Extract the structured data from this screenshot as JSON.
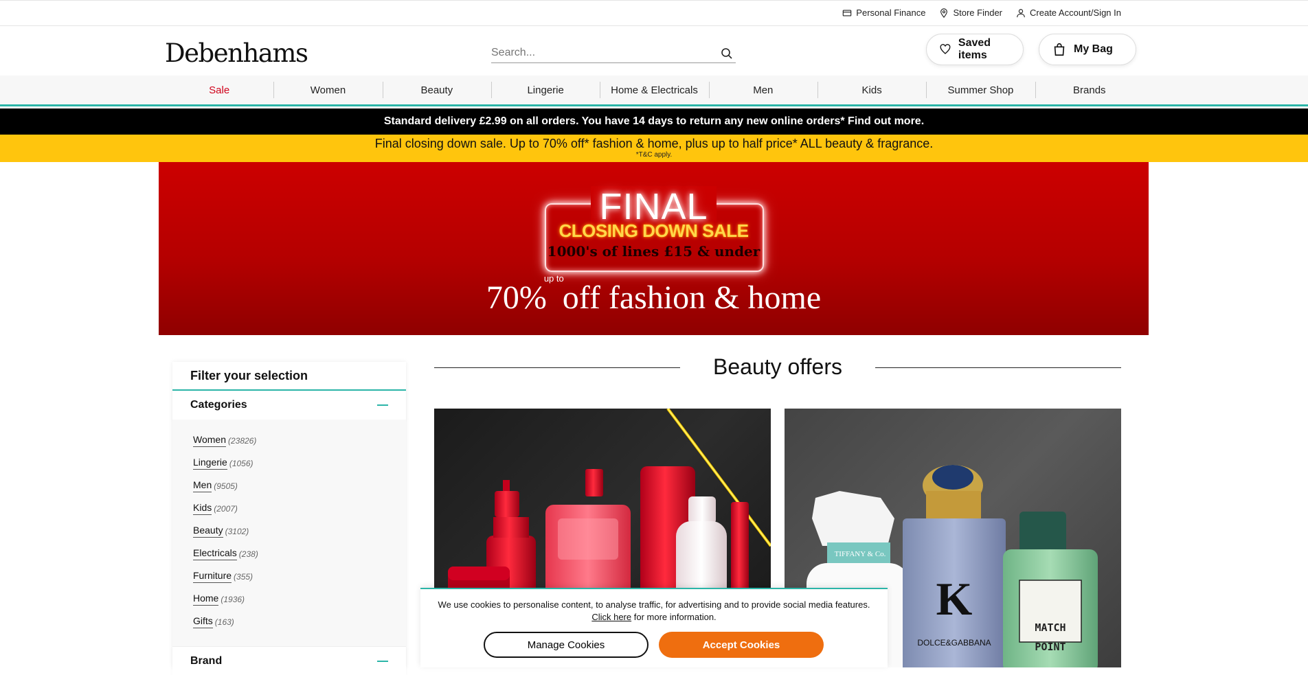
{
  "utility": {
    "personal_finance": "Personal Finance",
    "store_finder": "Store Finder",
    "account": "Create Account/Sign In"
  },
  "header": {
    "logo": "Debenhams",
    "search_placeholder": "Search...",
    "saved_items": "Saved items",
    "my_bag": "My Bag"
  },
  "nav": {
    "items": [
      "Sale",
      "Women",
      "Beauty",
      "Lingerie",
      "Home & Electricals",
      "Men",
      "Kids",
      "Summer Shop",
      "Brands"
    ]
  },
  "delivery_banner": "Standard delivery £2.99 on all orders. You have 14 days to return any new online orders* Find out more.",
  "promo_banner": {
    "main": "Final closing down sale. Up to 70% off* fashion & home, plus up to half price* ALL beauty & fragrance.",
    "tc": "*T&C apply."
  },
  "hero": {
    "final": "FINAL",
    "closing": "CLOSING DOWN SALE",
    "lines": "1000's of lines £15 & under",
    "percent": "70%",
    "up_to": "up to",
    "offer": "off fashion & home",
    "asterisk": "*"
  },
  "sidebar": {
    "title": "Filter your selection",
    "categories_label": "Categories",
    "categories": [
      {
        "name": "Women",
        "count": "(23826)"
      },
      {
        "name": "Lingerie",
        "count": "(1056)"
      },
      {
        "name": "Men",
        "count": "(9505)"
      },
      {
        "name": "Kids",
        "count": "(2007)"
      },
      {
        "name": "Beauty",
        "count": "(3102)"
      },
      {
        "name": "Electricals",
        "count": "(238)"
      },
      {
        "name": "Furniture",
        "count": "(355)"
      },
      {
        "name": "Home",
        "count": "(1936)"
      },
      {
        "name": "Gifts",
        "count": "(163)"
      }
    ],
    "brand_label": "Brand"
  },
  "main": {
    "heading": "Beauty offers",
    "cards": {
      "right": {
        "tiffany_label": "TIFFANY & Co.",
        "k_letter": "K",
        "dg_label": "DOLCE&GABBANA",
        "match_label": "MATCH",
        "point_label": "POINT"
      }
    }
  },
  "cookie": {
    "text": "We use cookies to personalise content, to analyse traffic, for advertising and to provide social media features.",
    "link": "Click here",
    "suffix": "for more information.",
    "manage": "Manage Cookies",
    "accept": "Accept Cookies"
  },
  "colors": {
    "accent_teal": "#2bb5a8",
    "sale_red": "#d0021b",
    "promo_yellow": "#ffc50d",
    "accept_orange": "#ef6e0f",
    "hero_red": "#cc0000"
  }
}
